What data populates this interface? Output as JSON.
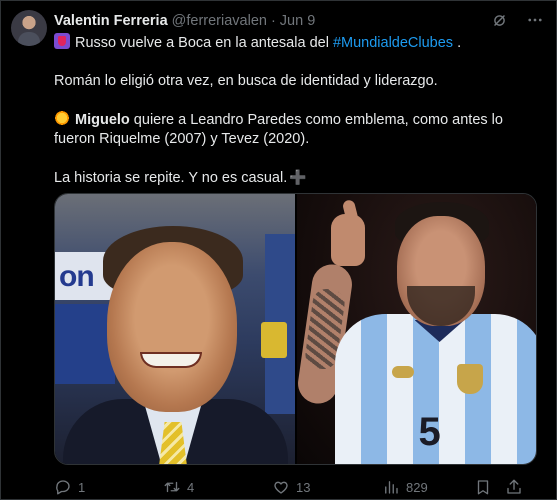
{
  "post": {
    "author_name": "Valentin Ferreria",
    "handle": "@ferreriavalen",
    "separator": "·",
    "date": "Jun 9",
    "line1_pre": "Russo vuelve a Boca en la antesala del ",
    "hashtag": "#MundialdeClubes",
    "line1_post": " .",
    "para2": "Román lo eligió otra vez, en busca de identidad y liderazgo.",
    "para3_bold": "Miguelo",
    "para3_rest_a": " quiere a Leandro Paredes como emblema, como antes lo",
    "para3_rest_b": "fueron Riquelme (2007) y Tevez (2020).",
    "para4": "La historia se repite. Y no es casual.",
    "para4_plus": "➕"
  },
  "media": {
    "left_sign_text": "on",
    "right_number": "5"
  },
  "actions": {
    "replies": "1",
    "reposts": "4",
    "likes": "13",
    "views": "829"
  },
  "icons": {
    "grok": "grok-icon",
    "more": "more-icon",
    "reply": "reply-icon",
    "repost": "repost-icon",
    "like": "heart-icon",
    "views": "views-icon",
    "bookmark": "bookmark-icon",
    "share": "share-icon"
  },
  "colors": {
    "background": "#000000",
    "text": "#e7e9ea",
    "muted": "#71767b",
    "link": "#1d9bf0"
  }
}
